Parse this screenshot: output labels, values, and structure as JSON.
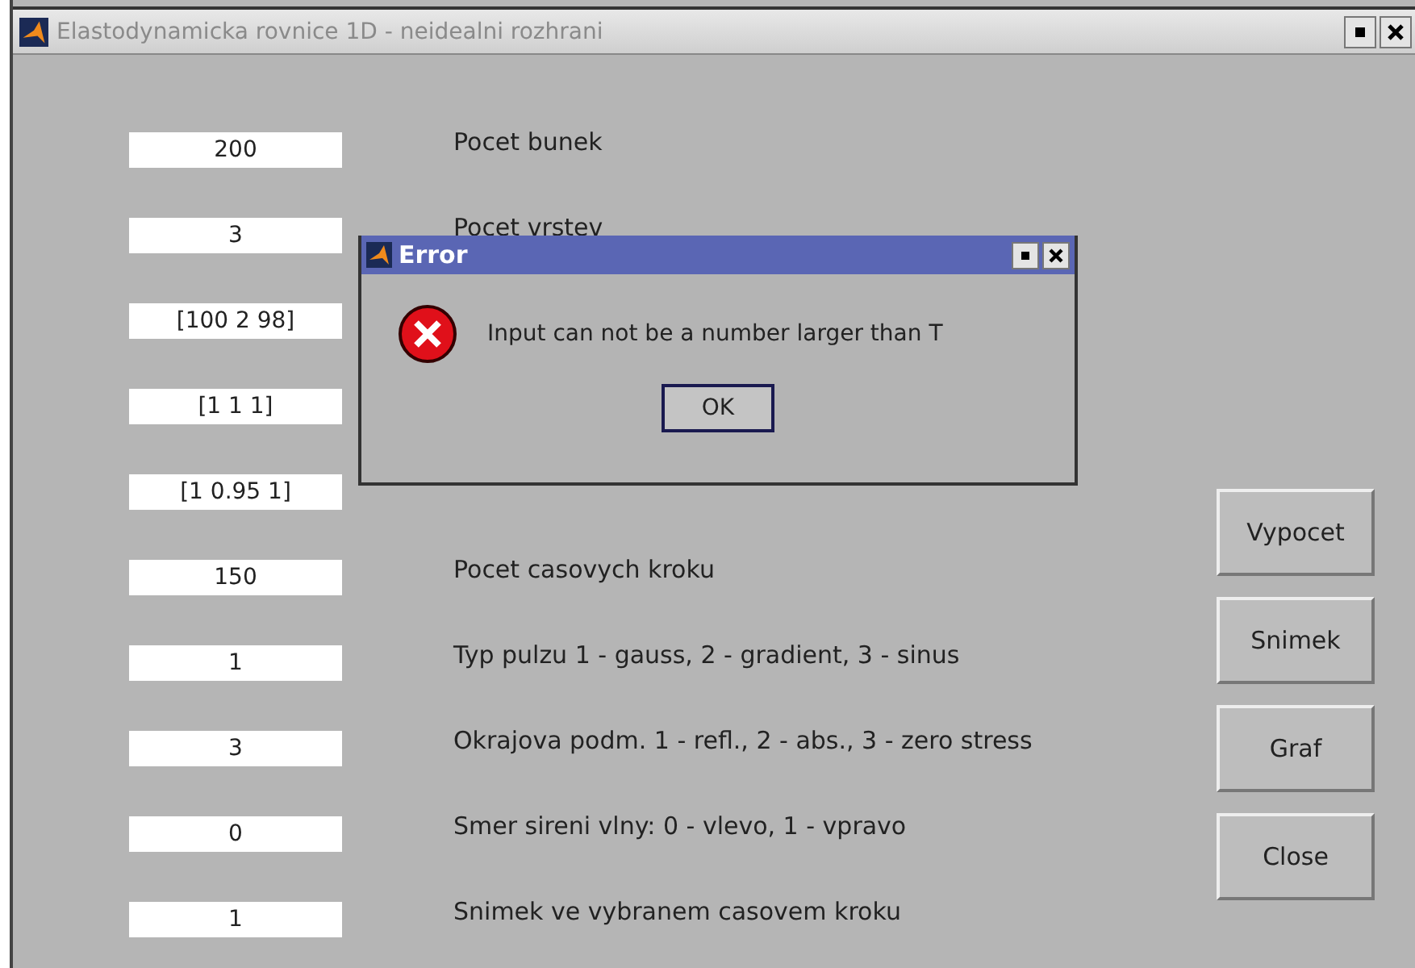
{
  "window": {
    "title": "Elastodynamicka rovnice 1D - neidealni rozhrani"
  },
  "rows": [
    {
      "value": "200",
      "label": "Pocet bunek"
    },
    {
      "value": "3",
      "label": "Pocet vrstev"
    },
    {
      "value": "[100 2 98]"
    },
    {
      "value": "[1 1 1]"
    },
    {
      "value": "[1 0.95 1]"
    },
    {
      "value": "150",
      "label": "Pocet casovych kroku"
    },
    {
      "value": "1",
      "label": "Typ pulzu 1 - gauss, 2 - gradient, 3 - sinus"
    },
    {
      "value": "3",
      "label": "Okrajova podm. 1 - refl., 2 - abs., 3 - zero stress"
    },
    {
      "value": "0",
      "label": "Smer sireni vlny: 0 - vlevo, 1 - vpravo"
    },
    {
      "value": "1",
      "label": "Snimek ve vybranem casovem kroku"
    }
  ],
  "buttons": [
    "Vypocet",
    "Snimek",
    "Graf",
    "Close"
  ],
  "dialog": {
    "title": "Error",
    "message": "Input can not be a number larger than T",
    "button": "OK"
  }
}
